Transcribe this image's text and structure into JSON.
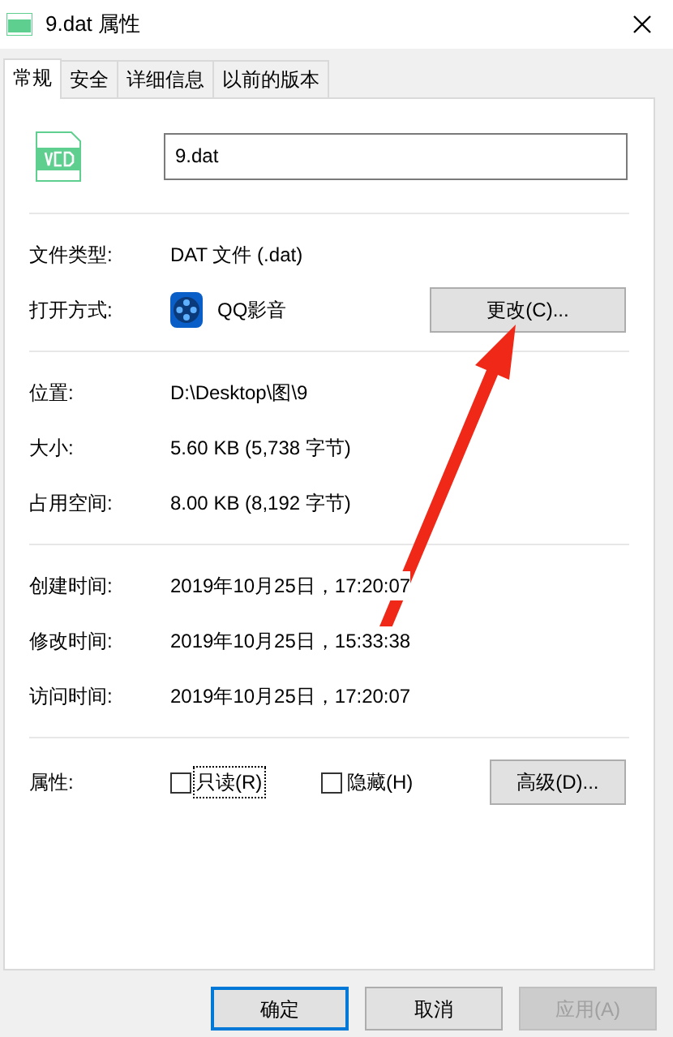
{
  "window": {
    "title": "9.dat 属性"
  },
  "tabs": [
    {
      "label": "常规",
      "selected": true
    },
    {
      "label": "安全",
      "selected": false
    },
    {
      "label": "详细信息",
      "selected": false
    },
    {
      "label": "以前的版本",
      "selected": false
    }
  ],
  "file_name": "9.dat",
  "sections": [
    [
      {
        "kind": "text",
        "label": "文件类型:",
        "value": "DAT 文件 (.dat)"
      },
      {
        "kind": "app",
        "label": "打开方式:",
        "value": "QQ影音",
        "button": "更改(C)..."
      }
    ],
    [
      {
        "kind": "text",
        "label": "位置:",
        "value": "D:\\Desktop\\图\\9"
      },
      {
        "kind": "text",
        "label": "大小:",
        "value": "5.60 KB (5,738 字节)"
      },
      {
        "kind": "text",
        "label": "占用空间:",
        "value": "8.00 KB (8,192 字节)"
      }
    ],
    [
      {
        "kind": "text",
        "label": "创建时间:",
        "value": "2019年10月25日，17:20:07"
      },
      {
        "kind": "text",
        "label": "修改时间:",
        "value": "2019年10月25日，15:33:38"
      },
      {
        "kind": "text",
        "label": "访问时间:",
        "value": "2019年10月25日，17:20:07"
      }
    ]
  ],
  "attributes": {
    "label": "属性:",
    "checkboxes": [
      {
        "label": "只读(R)",
        "checked": false,
        "focused": true
      },
      {
        "label": "隐藏(H)",
        "checked": false,
        "focused": false
      }
    ],
    "button": "高级(D)..."
  },
  "buttons": [
    {
      "label": "确定",
      "default": true,
      "disabled": false
    },
    {
      "label": "取消",
      "default": false,
      "disabled": false
    },
    {
      "label": "应用(A)",
      "default": false,
      "disabled": true
    }
  ]
}
